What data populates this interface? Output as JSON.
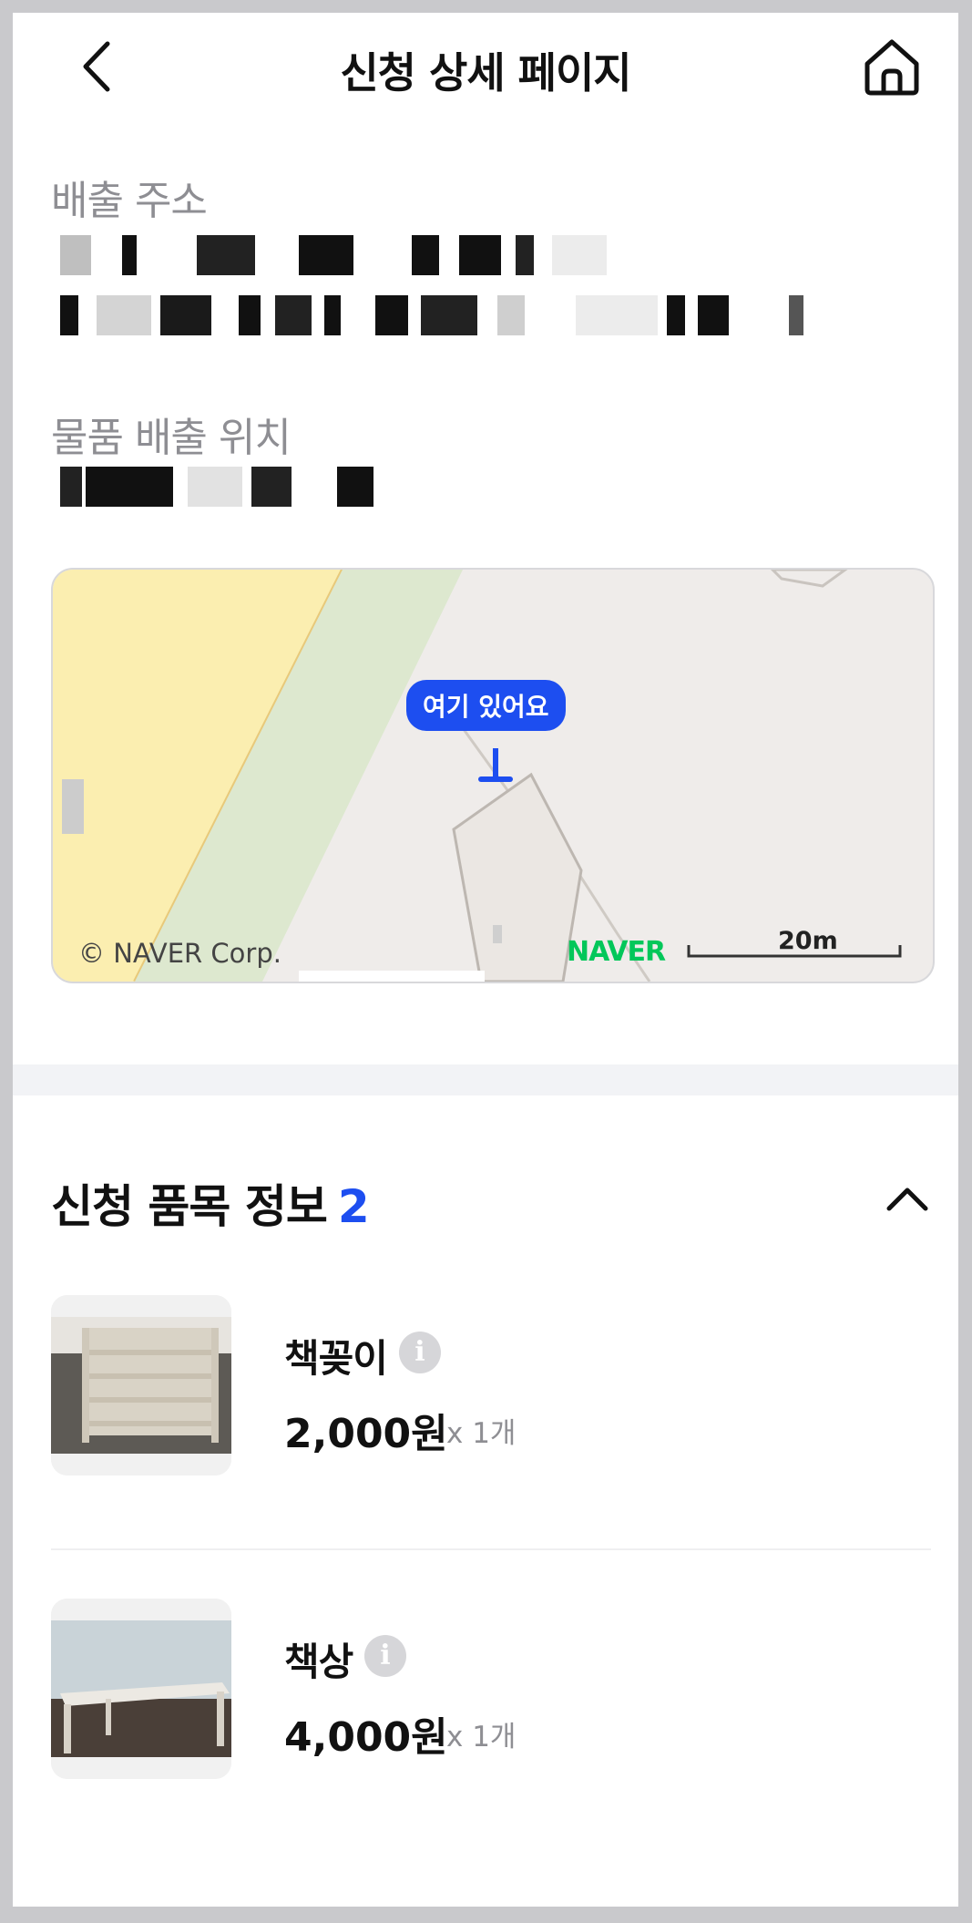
{
  "header": {
    "title": "신청 상세 페이지"
  },
  "address": {
    "label": "배출 주소"
  },
  "location": {
    "label": "물품 배출 위치"
  },
  "map": {
    "pin_label": "여기 있어요",
    "copyright": "© NAVER Corp.",
    "logo": "NAVER",
    "scale": "20m",
    "colors": {
      "road_yellow": "#fbeeb0",
      "park_green": "#dde8cf",
      "ground": "#efecea",
      "pin": "#1d4ef0"
    }
  },
  "items_section": {
    "title": "신청 품목 정보",
    "count": "2",
    "items": [
      {
        "name": "책꽂이",
        "price": "2,000원",
        "qty": "x 1개"
      },
      {
        "name": "책상",
        "price": "4,000원",
        "qty": "x 1개"
      }
    ]
  },
  "colors": {
    "accent": "#1d4ef0",
    "muted": "#8e8e93"
  }
}
